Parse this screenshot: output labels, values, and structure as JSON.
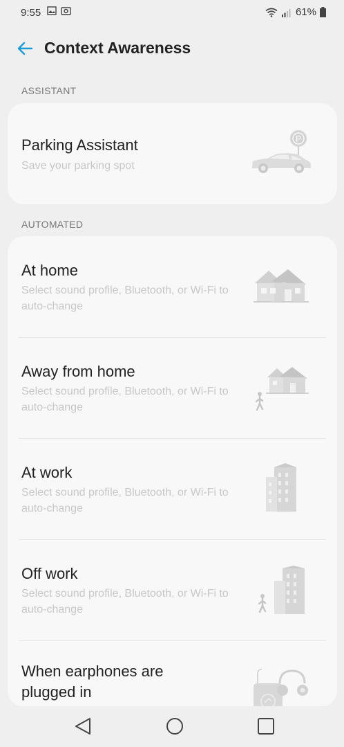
{
  "status_bar": {
    "time": "9:55",
    "battery": "61%",
    "icons": [
      "screenshot-icon",
      "image-icon",
      "wifi-icon",
      "signal-icon",
      "battery-icon"
    ]
  },
  "header": {
    "title": "Context Awareness",
    "back_icon": "back-arrow-icon"
  },
  "sections": {
    "assistant": {
      "label": "ASSISTANT"
    },
    "automated": {
      "label": "AUTOMATED"
    }
  },
  "items": {
    "parking": {
      "title": "Parking Assistant",
      "subtitle": "Save your parking spot",
      "icon": "parked-car-icon"
    },
    "at_home": {
      "title": "At home",
      "subtitle": "Select sound profile, Bluetooth, or Wi-Fi to auto-change",
      "icon": "house-icon"
    },
    "away_home": {
      "title": "Away from home",
      "subtitle": "Select sound profile, Bluetooth, or Wi-Fi to auto-change",
      "icon": "walking-from-house-icon"
    },
    "at_work": {
      "title": "At work",
      "subtitle": "Select sound profile, Bluetooth, or Wi-Fi to auto-change",
      "icon": "office-building-icon"
    },
    "off_work": {
      "title": "Off work",
      "subtitle": "Select sound profile, Bluetooth, or Wi-Fi to auto-change",
      "icon": "walking-from-building-icon"
    },
    "earphones": {
      "title": "When earphones are plugged in",
      "icon": "earphones-icon"
    }
  },
  "colors": {
    "accent": "#1a9ad6",
    "background": "#efefef",
    "card": "#f8f8f8"
  },
  "navbar": {
    "icons": [
      "back-triangle-icon",
      "home-circle-icon",
      "recents-square-icon"
    ]
  }
}
